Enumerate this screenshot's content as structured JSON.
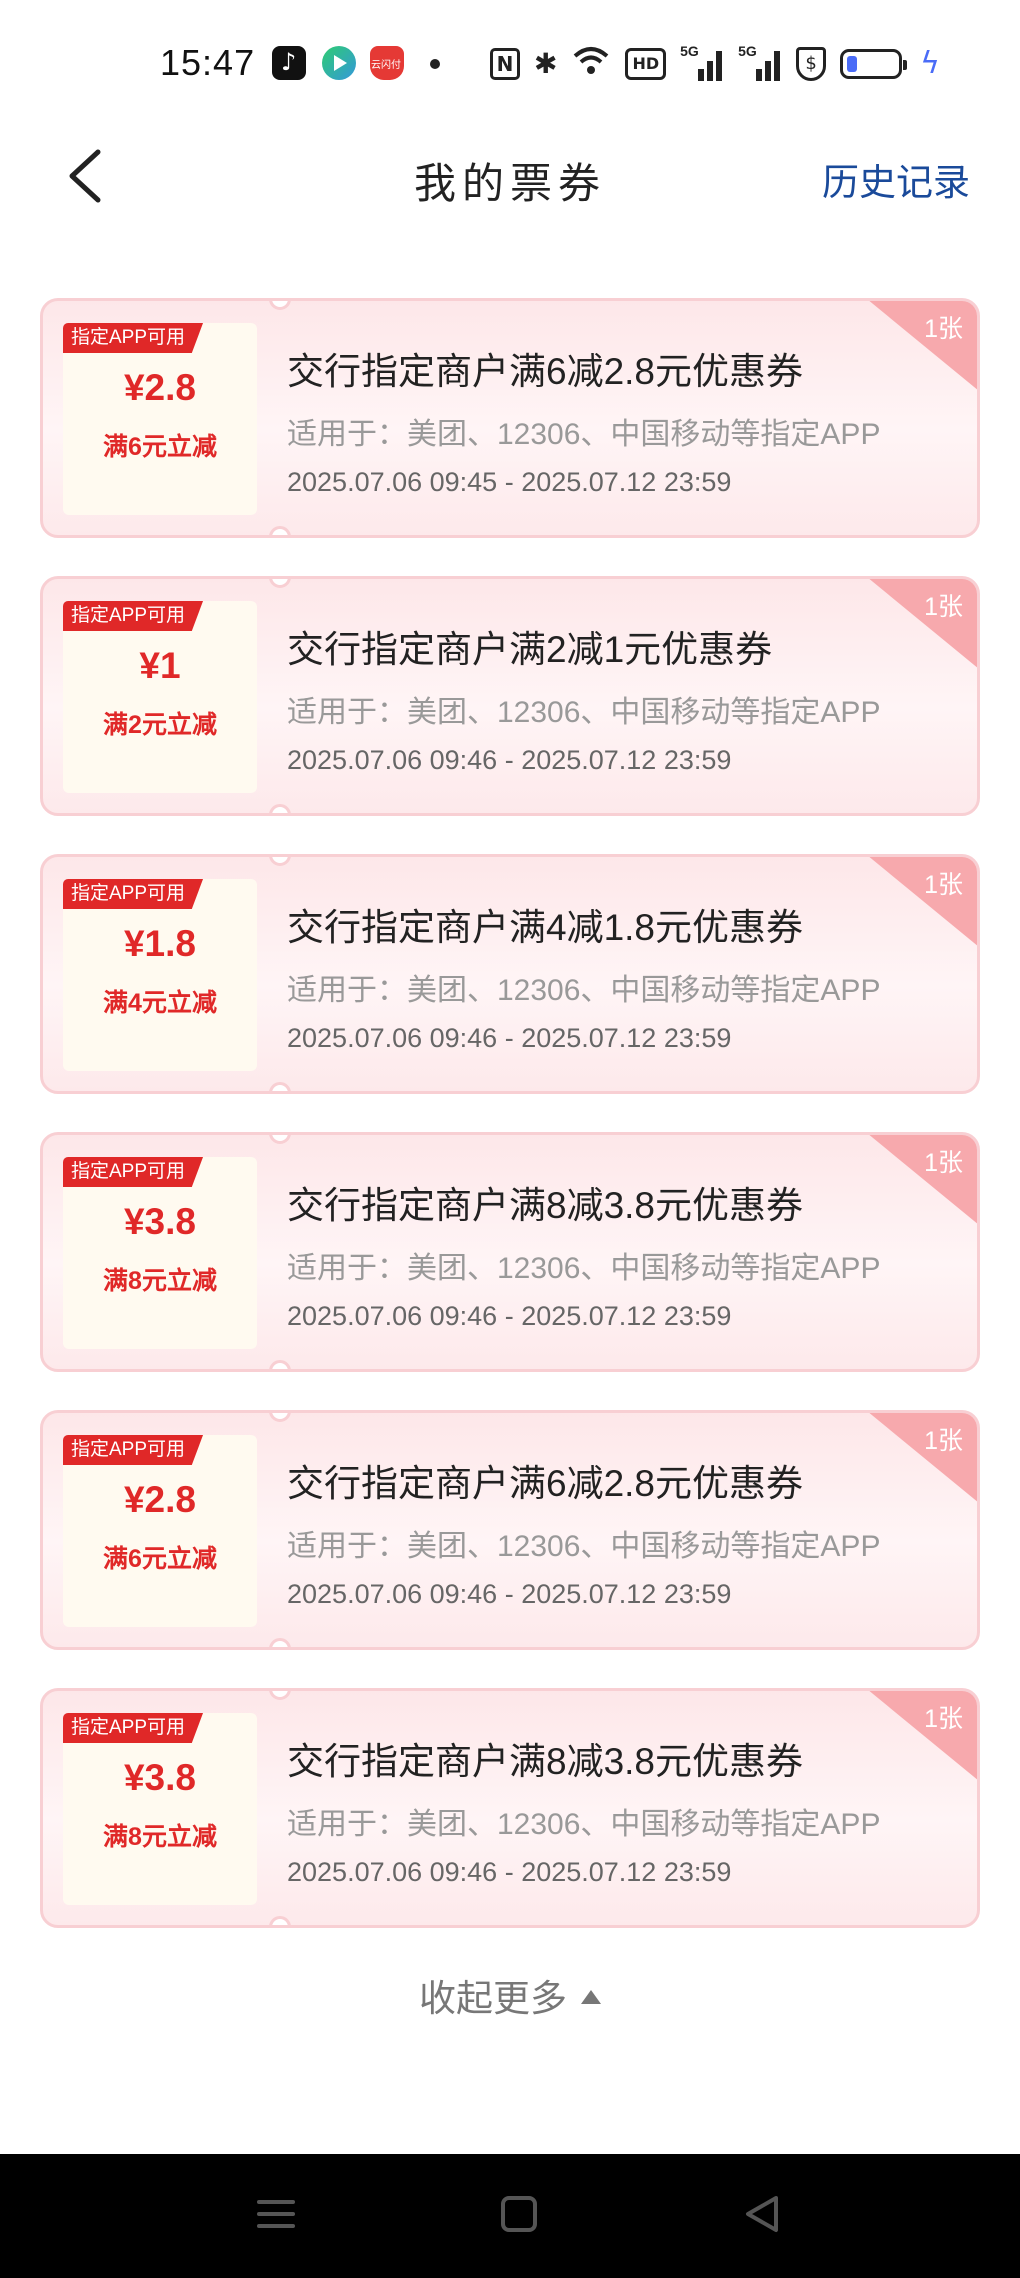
{
  "status_bar": {
    "time": "15:47",
    "icons": [
      "tiktok-icon",
      "video-app-icon",
      "yunshanfu-icon",
      "nfc-icon",
      "bluetooth-icon",
      "wifi-icon",
      "hd-icon",
      "signal-5g-icon",
      "shield-icon",
      "battery-icon",
      "charging-icon"
    ],
    "signal_label": "5G",
    "hd_label": "HD"
  },
  "header": {
    "title": "我的票券",
    "history_label": "历史记录"
  },
  "coupons": [
    {
      "tag": "指定APP可用",
      "amount": "¥2.8",
      "condition": "满6元立减",
      "title": "交行指定商户满6减2.8元优惠券",
      "scope": "适用于：美团、12306、中国移动等指定APP",
      "time": "2025.07.06 09:45 - 2025.07.12 23:59",
      "count": "1张"
    },
    {
      "tag": "指定APP可用",
      "amount": "¥1",
      "condition": "满2元立减",
      "title": "交行指定商户满2减1元优惠券",
      "scope": "适用于：美团、12306、中国移动等指定APP",
      "time": "2025.07.06 09:46 - 2025.07.12 23:59",
      "count": "1张"
    },
    {
      "tag": "指定APP可用",
      "amount": "¥1.8",
      "condition": "满4元立减",
      "title": "交行指定商户满4减1.8元优惠券",
      "scope": "适用于：美团、12306、中国移动等指定APP",
      "time": "2025.07.06 09:46 - 2025.07.12 23:59",
      "count": "1张"
    },
    {
      "tag": "指定APP可用",
      "amount": "¥3.8",
      "condition": "满8元立减",
      "title": "交行指定商户满8减3.8元优惠券",
      "scope": "适用于：美团、12306、中国移动等指定APP",
      "time": "2025.07.06 09:46 - 2025.07.12 23:59",
      "count": "1张"
    },
    {
      "tag": "指定APP可用",
      "amount": "¥2.8",
      "condition": "满6元立减",
      "title": "交行指定商户满6减2.8元优惠券",
      "scope": "适用于：美团、12306、中国移动等指定APP",
      "time": "2025.07.06 09:46 - 2025.07.12 23:59",
      "count": "1张"
    },
    {
      "tag": "指定APP可用",
      "amount": "¥3.8",
      "condition": "满8元立减",
      "title": "交行指定商户满8减3.8元优惠券",
      "scope": "适用于：美团、12306、中国移动等指定APP",
      "time": "2025.07.06 09:46 - 2025.07.12 23:59",
      "count": "1张"
    }
  ],
  "collapse_label": "收起更多",
  "colors": {
    "accent_red": "#e02828",
    "link_blue": "#1a4a9a",
    "coupon_bg": "#fde7e9",
    "corner_pink": "#f7a9ad"
  }
}
